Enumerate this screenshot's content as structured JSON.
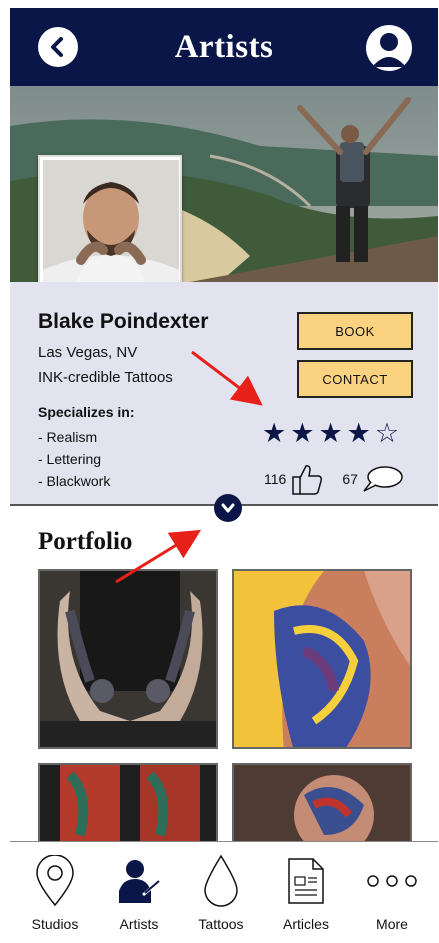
{
  "header": {
    "title": "Artists"
  },
  "artist": {
    "name": "Blake Poindexter",
    "location": "Las Vegas, NV",
    "studio": "INK-credible Tattoos",
    "specializes_label": "Specializes in:",
    "specialties": [
      "- Realism",
      "- Lettering",
      "- Blackwork"
    ],
    "rating": 4,
    "rating_max": 5,
    "likes": "116",
    "comments": "67"
  },
  "actions": {
    "book_label": "BOOK",
    "contact_label": "CONTACT"
  },
  "portfolio": {
    "title": "Portfolio"
  },
  "nav": {
    "items": [
      {
        "label": "Studios",
        "icon": "location-pin-icon"
      },
      {
        "label": "Artists",
        "icon": "artist-icon"
      },
      {
        "label": "Tattoos",
        "icon": "ink-drop-icon"
      },
      {
        "label": "Articles",
        "icon": "document-icon"
      },
      {
        "label": "More",
        "icon": "more-dots-icon"
      }
    ]
  },
  "colors": {
    "primary": "#0b1648",
    "accent": "#fbd27f",
    "panel": "#e2e3ef",
    "annotation": "#e8201a"
  }
}
